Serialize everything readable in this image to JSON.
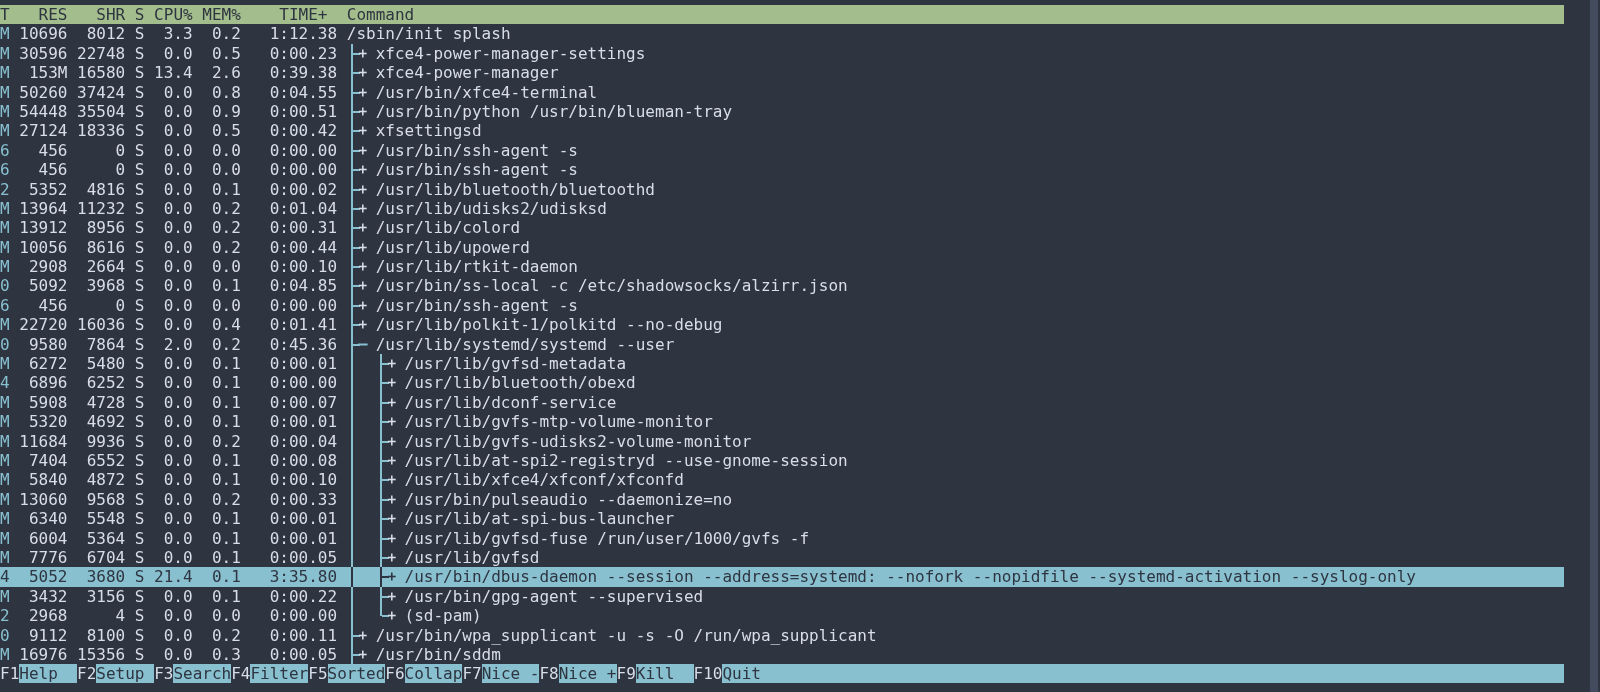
{
  "header": {
    "columns": [
      "T",
      "RES",
      "SHR",
      "S",
      "CPU%",
      "MEM%",
      "TIME+",
      "Command"
    ]
  },
  "processes": [
    {
      "cells": [
        "M",
        "10696",
        "8012",
        "S",
        "3.3",
        "0.2",
        "1:12.38"
      ],
      "command": "/sbin/init splash",
      "selected": false,
      "more_children_below": true,
      "children": [
        {
          "cells": [
            "M",
            "30596",
            "22748",
            "S",
            "0.0",
            "0.5",
            "0:00.23"
          ],
          "command": "xfce4-power-manager-settings",
          "expanded": false,
          "selected": false
        },
        {
          "cells": [
            "M",
            "153M",
            "16580",
            "S",
            "13.4",
            "2.6",
            "0:39.38"
          ],
          "command": "xfce4-power-manager",
          "expanded": false,
          "selected": false
        },
        {
          "cells": [
            "M",
            "50260",
            "37424",
            "S",
            "0.0",
            "0.8",
            "0:04.55"
          ],
          "command": "/usr/bin/xfce4-terminal",
          "expanded": false,
          "selected": false
        },
        {
          "cells": [
            "M",
            "54448",
            "35504",
            "S",
            "0.0",
            "0.9",
            "0:00.51"
          ],
          "command": "/usr/bin/python /usr/bin/blueman-tray",
          "expanded": false,
          "selected": false
        },
        {
          "cells": [
            "M",
            "27124",
            "18336",
            "S",
            "0.0",
            "0.5",
            "0:00.42"
          ],
          "command": "xfsettingsd",
          "expanded": false,
          "selected": false
        },
        {
          "cells": [
            "6",
            "456",
            "0",
            "S",
            "0.0",
            "0.0",
            "0:00.00"
          ],
          "command": "/usr/bin/ssh-agent -s",
          "expanded": false,
          "selected": false
        },
        {
          "cells": [
            "6",
            "456",
            "0",
            "S",
            "0.0",
            "0.0",
            "0:00.00"
          ],
          "command": "/usr/bin/ssh-agent -s",
          "expanded": false,
          "selected": false
        },
        {
          "cells": [
            "2",
            "5352",
            "4816",
            "S",
            "0.0",
            "0.1",
            "0:00.02"
          ],
          "command": "/usr/lib/bluetooth/bluetoothd",
          "expanded": false,
          "selected": false
        },
        {
          "cells": [
            "M",
            "13964",
            "11232",
            "S",
            "0.0",
            "0.2",
            "0:01.04"
          ],
          "command": "/usr/lib/udisks2/udisksd",
          "expanded": false,
          "selected": false
        },
        {
          "cells": [
            "M",
            "13912",
            "8956",
            "S",
            "0.0",
            "0.2",
            "0:00.31"
          ],
          "command": "/usr/lib/colord",
          "expanded": false,
          "selected": false
        },
        {
          "cells": [
            "M",
            "10056",
            "8616",
            "S",
            "0.0",
            "0.2",
            "0:00.44"
          ],
          "command": "/usr/lib/upowerd",
          "expanded": false,
          "selected": false
        },
        {
          "cells": [
            "M",
            "2908",
            "2664",
            "S",
            "0.0",
            "0.0",
            "0:00.10"
          ],
          "command": "/usr/lib/rtkit-daemon",
          "expanded": false,
          "selected": false
        },
        {
          "cells": [
            "0",
            "5092",
            "3968",
            "S",
            "0.0",
            "0.1",
            "0:04.85"
          ],
          "command": "/usr/bin/ss-local -c /etc/shadowsocks/alzirr.json",
          "expanded": false,
          "selected": false
        },
        {
          "cells": [
            "6",
            "456",
            "0",
            "S",
            "0.0",
            "0.0",
            "0:00.00"
          ],
          "command": "/usr/bin/ssh-agent -s",
          "expanded": false,
          "selected": false
        },
        {
          "cells": [
            "M",
            "22720",
            "16036",
            "S",
            "0.0",
            "0.4",
            "0:01.41"
          ],
          "command": "/usr/lib/polkit-1/polkitd --no-debug",
          "expanded": false,
          "selected": false
        },
        {
          "cells": [
            "0",
            "9580",
            "7864",
            "S",
            "2.0",
            "0.2",
            "0:45.36"
          ],
          "command": "/usr/lib/systemd/systemd --user",
          "expanded": true,
          "selected": false,
          "children": [
            {
              "cells": [
                "M",
                "6272",
                "5480",
                "S",
                "0.0",
                "0.1",
                "0:00.01"
              ],
              "command": "/usr/lib/gvfsd-metadata",
              "expanded": false,
              "selected": false
            },
            {
              "cells": [
                "4",
                "6896",
                "6252",
                "S",
                "0.0",
                "0.1",
                "0:00.00"
              ],
              "command": "/usr/lib/bluetooth/obexd",
              "expanded": false,
              "selected": false
            },
            {
              "cells": [
                "M",
                "5908",
                "4728",
                "S",
                "0.0",
                "0.1",
                "0:00.07"
              ],
              "command": "/usr/lib/dconf-service",
              "expanded": false,
              "selected": false
            },
            {
              "cells": [
                "M",
                "5320",
                "4692",
                "S",
                "0.0",
                "0.1",
                "0:00.01"
              ],
              "command": "/usr/lib/gvfs-mtp-volume-monitor",
              "expanded": false,
              "selected": false
            },
            {
              "cells": [
                "M",
                "11684",
                "9936",
                "S",
                "0.0",
                "0.2",
                "0:00.04"
              ],
              "command": "/usr/lib/gvfs-udisks2-volume-monitor",
              "expanded": false,
              "selected": false
            },
            {
              "cells": [
                "M",
                "7404",
                "6552",
                "S",
                "0.0",
                "0.1",
                "0:00.08"
              ],
              "command": "/usr/lib/at-spi2-registryd --use-gnome-session",
              "expanded": false,
              "selected": false
            },
            {
              "cells": [
                "M",
                "5840",
                "4872",
                "S",
                "0.0",
                "0.1",
                "0:00.10"
              ],
              "command": "/usr/lib/xfce4/xfconf/xfconfd",
              "expanded": false,
              "selected": false
            },
            {
              "cells": [
                "M",
                "13060",
                "9568",
                "S",
                "0.0",
                "0.2",
                "0:00.33"
              ],
              "command": "/usr/bin/pulseaudio --daemonize=no",
              "expanded": false,
              "selected": false
            },
            {
              "cells": [
                "M",
                "6340",
                "5548",
                "S",
                "0.0",
                "0.1",
                "0:00.01"
              ],
              "command": "/usr/lib/at-spi-bus-launcher",
              "expanded": false,
              "selected": false
            },
            {
              "cells": [
                "M",
                "6004",
                "5364",
                "S",
                "0.0",
                "0.1",
                "0:00.01"
              ],
              "command": "/usr/lib/gvfsd-fuse /run/user/1000/gvfs -f",
              "expanded": false,
              "selected": false
            },
            {
              "cells": [
                "M",
                "7776",
                "6704",
                "S",
                "0.0",
                "0.1",
                "0:00.05"
              ],
              "command": "/usr/lib/gvfsd",
              "expanded": false,
              "selected": false
            },
            {
              "cells": [
                "4",
                "5052",
                "3680",
                "S",
                "21.4",
                "0.1",
                "3:35.80"
              ],
              "command": "/usr/bin/dbus-daemon --session --address=systemd: --nofork --nopidfile --systemd-activation --syslog-only",
              "expanded": false,
              "selected": true
            },
            {
              "cells": [
                "M",
                "3432",
                "3156",
                "S",
                "0.0",
                "0.1",
                "0:00.22"
              ],
              "command": "/usr/bin/gpg-agent --supervised",
              "expanded": false,
              "selected": false
            },
            {
              "cells": [
                "2",
                "2968",
                "4",
                "S",
                "0.0",
                "0.0",
                "0:00.00"
              ],
              "command": "(sd-pam)",
              "expanded": false,
              "selected": false
            }
          ]
        },
        {
          "cells": [
            "0",
            "9112",
            "8100",
            "S",
            "0.0",
            "0.2",
            "0:00.11"
          ],
          "command": "/usr/bin/wpa_supplicant -u -s -O /run/wpa_supplicant",
          "expanded": false,
          "selected": false
        },
        {
          "cells": [
            "M",
            "16976",
            "15356",
            "S",
            "0.0",
            "0.3",
            "0:00.05"
          ],
          "command": "/usr/bin/sddm",
          "expanded": false,
          "selected": false
        }
      ]
    }
  ],
  "function_keys": [
    {
      "key": "F1",
      "label": "Help"
    },
    {
      "key": "F2",
      "label": "Setup"
    },
    {
      "key": "F3",
      "label": "Search"
    },
    {
      "key": "F4",
      "label": "Filter"
    },
    {
      "key": "F5",
      "label": "Sorted"
    },
    {
      "key": "F6",
      "label": "Collap"
    },
    {
      "key": "F7",
      "label": "Nice -"
    },
    {
      "key": "F8",
      "label": "Nice +"
    },
    {
      "key": "F9",
      "label": "Kill"
    },
    {
      "key": "F10",
      "label": "Quit"
    }
  ]
}
